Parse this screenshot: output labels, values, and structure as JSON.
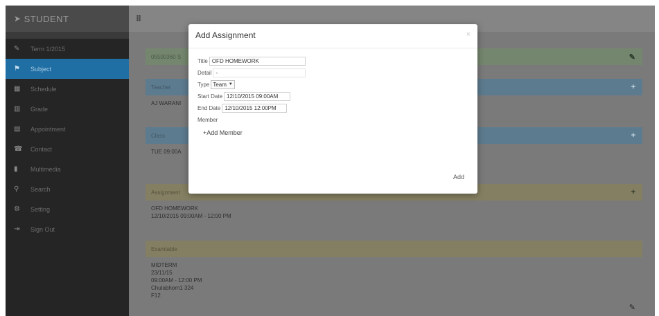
{
  "sidebar": {
    "brand": "STUDENT",
    "items": [
      {
        "icon": "edit-icon",
        "glyph": "✎",
        "label": "Term 1/2015"
      },
      {
        "icon": "flag-icon",
        "glyph": "⚑",
        "label": "Subject"
      },
      {
        "icon": "calendar-icon",
        "glyph": "▦",
        "label": "Schedule"
      },
      {
        "icon": "chart-icon",
        "glyph": "▥",
        "label": "Grade"
      },
      {
        "icon": "calendar-appointment-icon",
        "glyph": "▤",
        "label": "Appointment"
      },
      {
        "icon": "contact-icon",
        "glyph": "☎",
        "label": "Contact"
      },
      {
        "icon": "file-icon",
        "glyph": "▮",
        "label": "Multimedia"
      },
      {
        "icon": "search-icon",
        "glyph": "⚲",
        "label": "Search"
      },
      {
        "icon": "gear-icon",
        "glyph": "⚙",
        "label": "Setting"
      },
      {
        "icon": "sign-out-icon",
        "glyph": "⇥",
        "label": "Sign Out"
      }
    ]
  },
  "content": {
    "course": "05500360 S",
    "teacher_header": "Teacher",
    "teacher": "AJ WARANI",
    "class_header": "Class",
    "class_time": "TUE 09:00A",
    "assignment_header": "Assignment",
    "assignment_title": "OFD HOMEWORK",
    "assignment_time": "12/10/2015 09:00AM - 12:00 PM",
    "exam_header": "Examtable",
    "exam_lines": [
      "MIDTERM",
      "23/11/15",
      "09:00AM - 12:00 PM",
      "Chulabhorn1 324",
      "F12"
    ]
  },
  "modal": {
    "title": "Add Assignment",
    "close": "×",
    "title_label": "Title",
    "title_value": "OFD HOMEWORK",
    "detail_label": "Detail",
    "detail_value": "-",
    "type_label": "Type",
    "type_value": "Team",
    "start_label": "Start Date",
    "start_value": "12/10/2015 09:00AM",
    "end_label": "End Date",
    "end_value": "12/10/2015 12:00PM",
    "member_label": "Member",
    "add_member": "+Add Member",
    "add_button": "Add"
  }
}
